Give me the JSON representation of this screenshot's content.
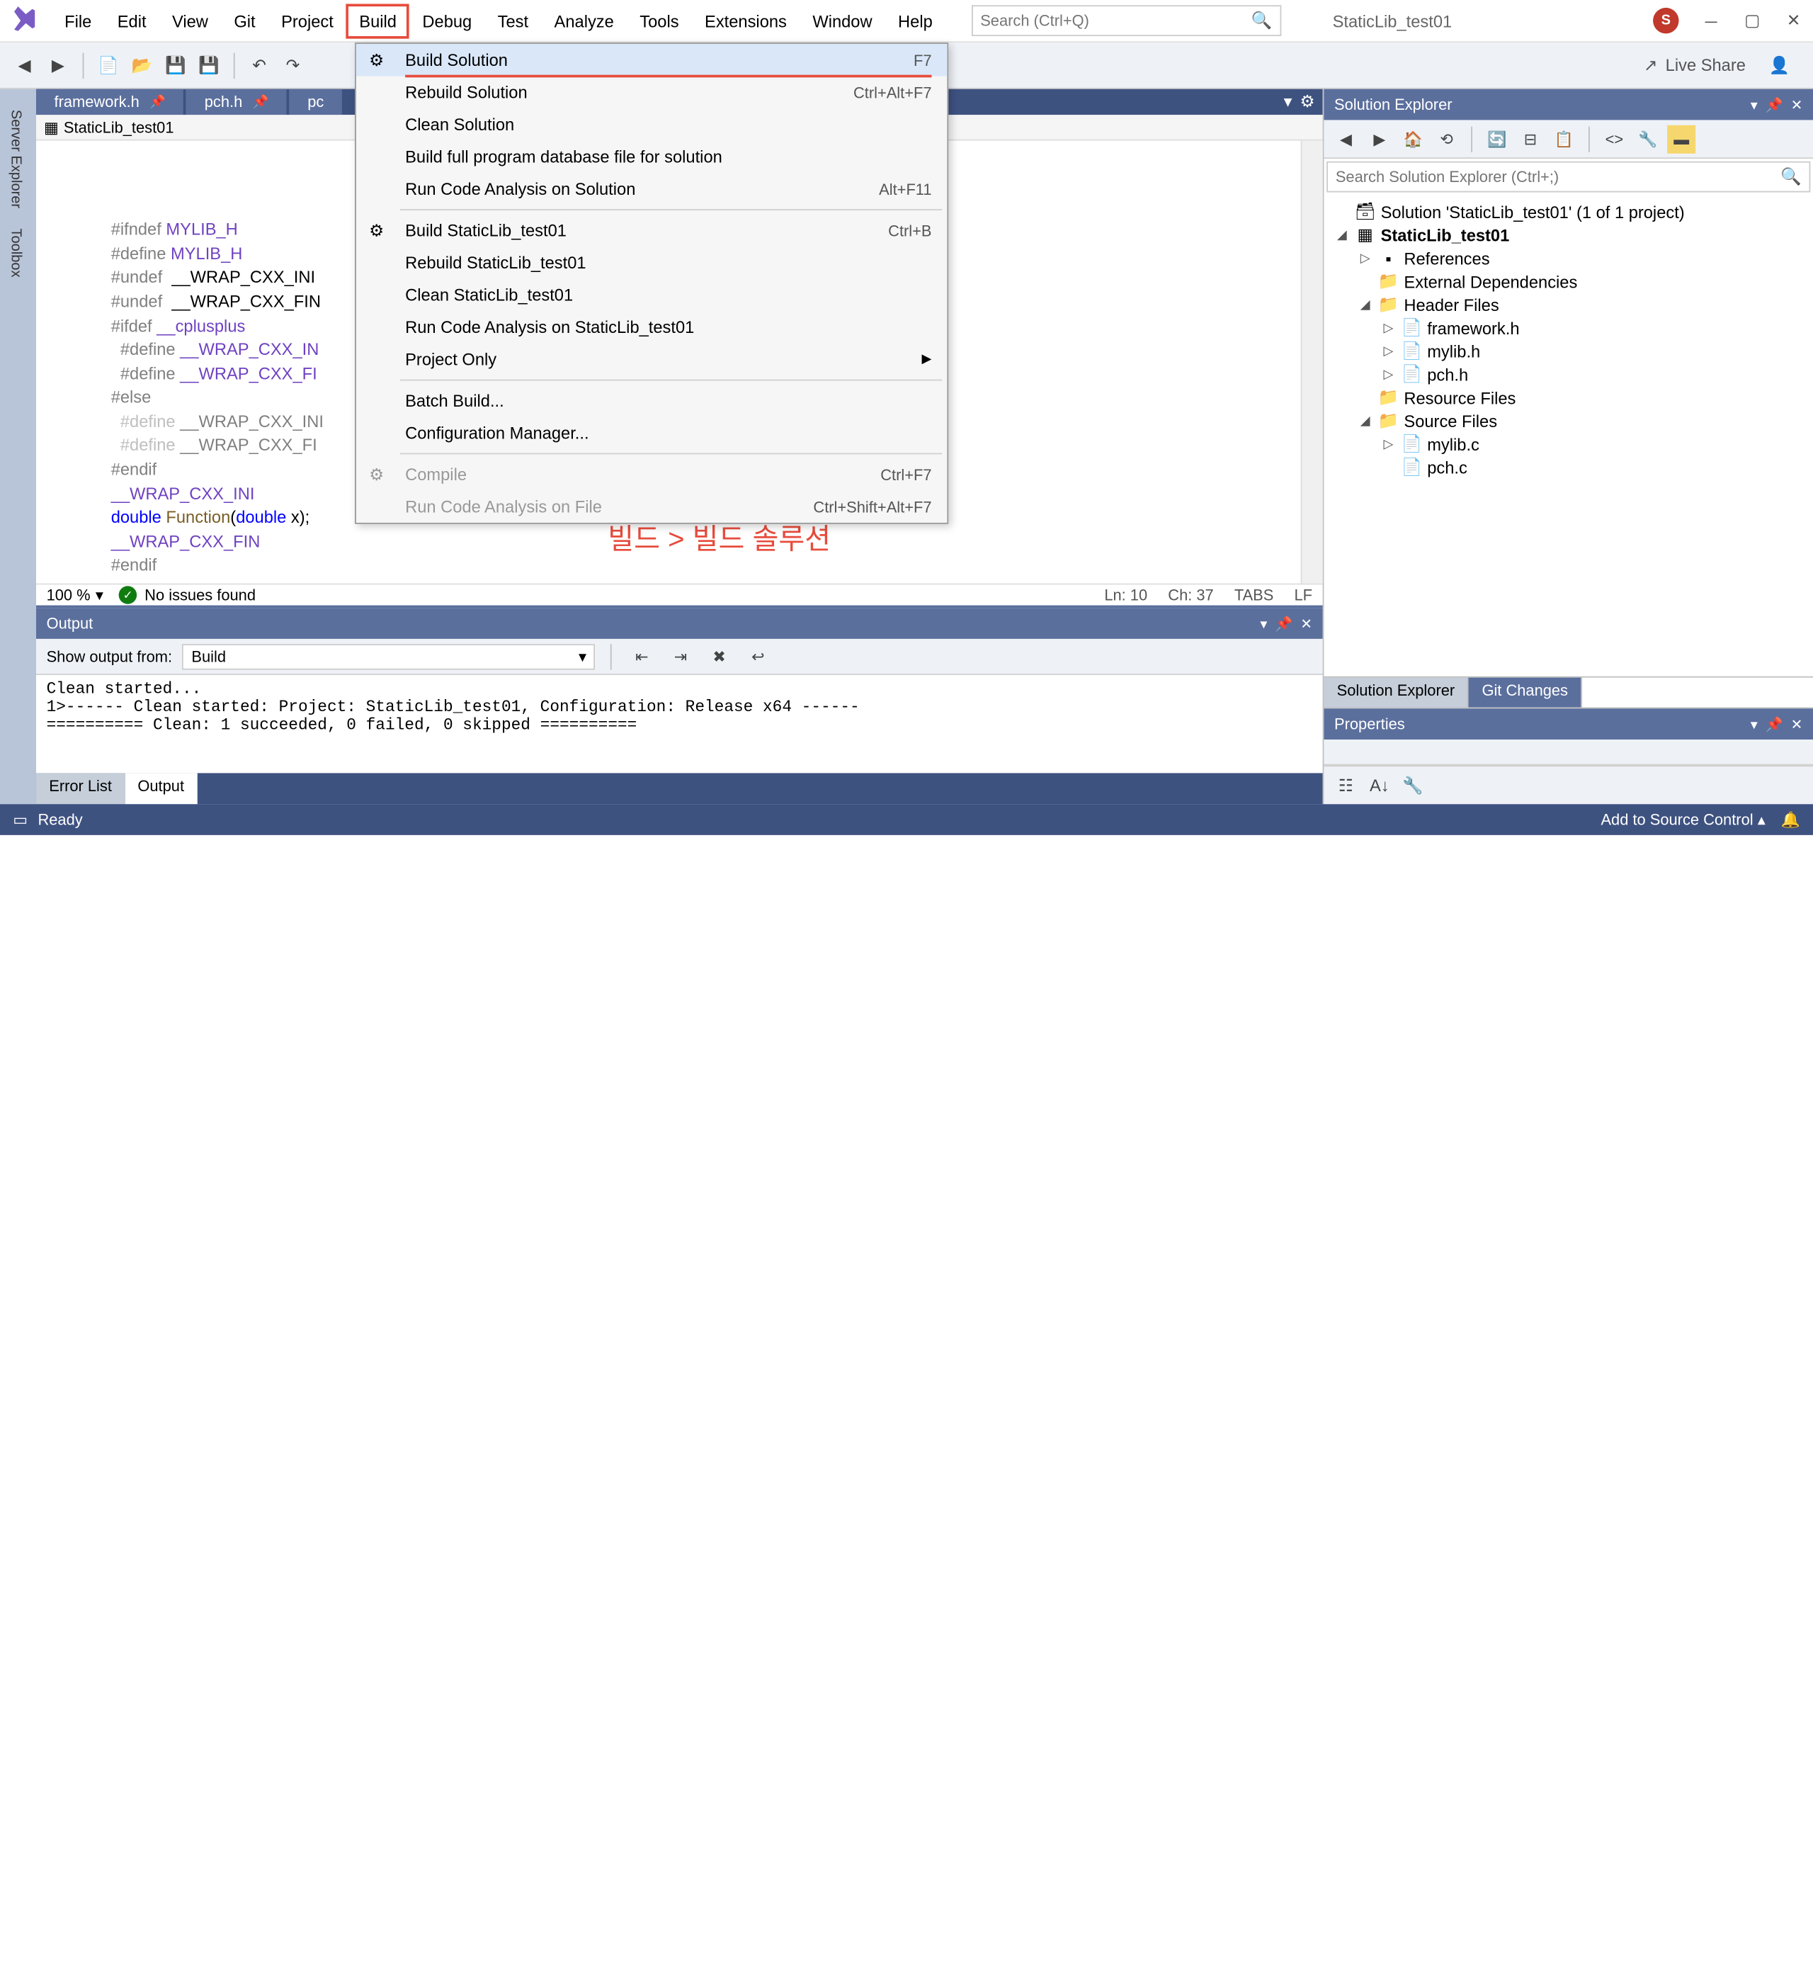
{
  "menubar": {
    "items": [
      "File",
      "Edit",
      "View",
      "Git",
      "Project",
      "Build",
      "Debug",
      "Test",
      "Analyze",
      "Tools",
      "Extensions",
      "Window",
      "Help"
    ],
    "highlighted": "Build"
  },
  "search": {
    "placeholder": "Search (Ctrl+Q)"
  },
  "title_doc": "StaticLib_test01",
  "user_initial": "S",
  "live_share": "Live Share",
  "side_tabs": [
    "Server Explorer",
    "Toolbox"
  ],
  "file_tabs": [
    {
      "label": "framework.h",
      "pinned": true
    },
    {
      "label": "pch.h",
      "pinned": true
    },
    {
      "label": "pc",
      "pinned": false
    }
  ],
  "nav_combo": "StaticLib_test01",
  "code_lines": [
    {
      "indent": 0,
      "parts": [
        {
          "c": "kw-directive",
          "t": "#ifndef "
        },
        {
          "c": "kw-macro",
          "t": "MYLIB_H"
        }
      ],
      "fold": true
    },
    {
      "indent": 0,
      "parts": [
        {
          "c": "kw-directive",
          "t": "#define "
        },
        {
          "c": "kw-macro",
          "t": "MYLIB_H"
        }
      ]
    },
    {
      "indent": 0,
      "parts": [
        {
          "c": "",
          "t": ""
        }
      ]
    },
    {
      "indent": 0,
      "parts": [
        {
          "c": "kw-directive",
          "t": "#undef  "
        },
        {
          "c": "",
          "t": "__WRAP_CXX_INI"
        }
      ]
    },
    {
      "indent": 0,
      "parts": [
        {
          "c": "kw-directive",
          "t": "#undef  "
        },
        {
          "c": "",
          "t": "__WRAP_CXX_FIN"
        }
      ]
    },
    {
      "indent": 0,
      "parts": [
        {
          "c": "kw-directive",
          "t": "#ifdef "
        },
        {
          "c": "kw-macro",
          "t": "__cplusplus"
        }
      ],
      "fold": true
    },
    {
      "indent": 1,
      "parts": [
        {
          "c": "kw-directive",
          "t": "#define "
        },
        {
          "c": "kw-macro",
          "t": "__WRAP_CXX_IN"
        }
      ]
    },
    {
      "indent": 1,
      "parts": [
        {
          "c": "kw-directive",
          "t": "#define "
        },
        {
          "c": "kw-macro",
          "t": "__WRAP_CXX_FI"
        }
      ]
    },
    {
      "indent": 0,
      "parts": [
        {
          "c": "kw-directive",
          "t": "#else"
        }
      ],
      "fold": true
    },
    {
      "indent": 1,
      "parts": [
        {
          "c": "kw-directive",
          "t": "#define "
        },
        {
          "c": "",
          "t": "__WRAP_CXX_INI"
        }
      ],
      "dim": true
    },
    {
      "indent": 1,
      "parts": [
        {
          "c": "kw-directive",
          "t": "#define "
        },
        {
          "c": "",
          "t": "__WRAP_CXX_FI"
        }
      ],
      "dim": true
    },
    {
      "indent": 0,
      "parts": [
        {
          "c": "kw-directive",
          "t": "#endif"
        }
      ]
    },
    {
      "indent": 0,
      "parts": [
        {
          "c": "",
          "t": ""
        }
      ]
    },
    {
      "indent": 0,
      "parts": [
        {
          "c": "kw-macro",
          "t": "__WRAP_CXX_INI"
        }
      ]
    },
    {
      "indent": 0,
      "parts": [
        {
          "c": "",
          "t": ""
        }
      ]
    },
    {
      "indent": 0,
      "parts": [
        {
          "c": "kw-blue",
          "t": "double "
        },
        {
          "c": "kw-func",
          "t": "Function"
        },
        {
          "c": "",
          "t": "("
        },
        {
          "c": "kw-blue",
          "t": "double "
        },
        {
          "c": "",
          "t": "x);"
        }
      ]
    },
    {
      "indent": 0,
      "parts": [
        {
          "c": "",
          "t": ""
        }
      ]
    },
    {
      "indent": 0,
      "parts": [
        {
          "c": "kw-macro",
          "t": "__WRAP_CXX_FIN"
        }
      ]
    },
    {
      "indent": 0,
      "parts": [
        {
          "c": "",
          "t": ""
        }
      ]
    },
    {
      "indent": 0,
      "parts": [
        {
          "c": "kw-directive",
          "t": "#endif"
        }
      ]
    }
  ],
  "annotation": "빌드 > 빌드 솔루션",
  "status_line": {
    "zoom": "100 %",
    "issues": "No issues found",
    "ln": "Ln: 10",
    "ch": "Ch: 37",
    "tabs": "TABS",
    "lf": "LF"
  },
  "dropdown": [
    {
      "type": "item",
      "label": "Build Solution",
      "shortcut": "F7",
      "icon": true,
      "highlighted": true
    },
    {
      "type": "item",
      "label": "Rebuild Solution",
      "shortcut": "Ctrl+Alt+F7"
    },
    {
      "type": "item",
      "label": "Clean Solution"
    },
    {
      "type": "item",
      "label": "Build full program database file for solution"
    },
    {
      "type": "item",
      "label": "Run Code Analysis on Solution",
      "shortcut": "Alt+F11"
    },
    {
      "type": "sep"
    },
    {
      "type": "item",
      "label": "Build StaticLib_test01",
      "shortcut": "Ctrl+B",
      "icon": true
    },
    {
      "type": "item",
      "label": "Rebuild StaticLib_test01"
    },
    {
      "type": "item",
      "label": "Clean StaticLib_test01"
    },
    {
      "type": "item",
      "label": "Run Code Analysis on StaticLib_test01"
    },
    {
      "type": "item",
      "label": "Project Only",
      "arrow": true
    },
    {
      "type": "sep"
    },
    {
      "type": "item",
      "label": "Batch Build..."
    },
    {
      "type": "item",
      "label": "Configuration Manager..."
    },
    {
      "type": "sep"
    },
    {
      "type": "item",
      "label": "Compile",
      "shortcut": "Ctrl+F7",
      "icon": true,
      "disabled": true
    },
    {
      "type": "item",
      "label": "Run Code Analysis on File",
      "shortcut": "Ctrl+Shift+Alt+F7",
      "disabled": true
    }
  ],
  "solution_explorer": {
    "title": "Solution Explorer",
    "search_placeholder": "Search Solution Explorer (Ctrl+;)",
    "solution_label": "Solution 'StaticLib_test01' (1 of 1 project)",
    "project": "StaticLib_test01",
    "refs": "References",
    "ext_deps": "External Dependencies",
    "header_files": "Header Files",
    "headers": [
      "framework.h",
      "mylib.h",
      "pch.h"
    ],
    "resource_files": "Resource Files",
    "source_files": "Source Files",
    "sources": [
      "mylib.c",
      "pch.c"
    ],
    "tabs": [
      "Solution Explorer",
      "Git Changes"
    ]
  },
  "properties": {
    "title": "Properties"
  },
  "output": {
    "title": "Output",
    "show_label": "Show output from:",
    "show_value": "Build",
    "text": "Clean started...\n1>------ Clean started: Project: StaticLib_test01, Configuration: Release x64 ------\n========== Clean: 1 succeeded, 0 failed, 0 skipped ==========",
    "tabs": [
      "Error List",
      "Output"
    ]
  },
  "statusbar": {
    "ready": "Ready",
    "source_control": "Add to Source Control"
  }
}
